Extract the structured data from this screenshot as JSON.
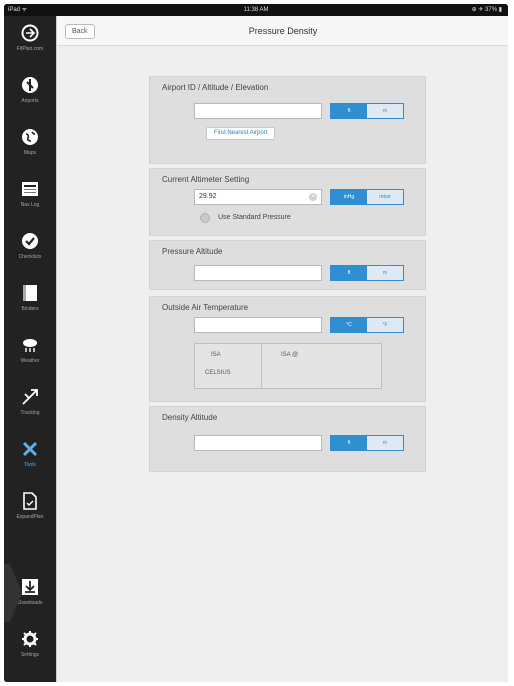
{
  "status": {
    "carrier": "iPad ᯤ",
    "time": "11:38 AM",
    "battery": "⊕ ✈ 37% ▮"
  },
  "sidebar": {
    "items": [
      {
        "label": "FltPlan.com",
        "icon": "fltplan-logo-icon"
      },
      {
        "label": "Airports",
        "icon": "airport-icon"
      },
      {
        "label": "Maps",
        "icon": "globe-icon"
      },
      {
        "label": "Nav Log",
        "icon": "navlog-icon"
      },
      {
        "label": "Checklists",
        "icon": "checkmark-icon"
      },
      {
        "label": "Binders",
        "icon": "binder-icon"
      },
      {
        "label": "Weather",
        "icon": "weather-icon"
      },
      {
        "label": "Tracking",
        "icon": "tracking-icon"
      },
      {
        "label": "Tools",
        "icon": "tools-icon",
        "active": true
      },
      {
        "label": "ExpandPlan",
        "icon": "document-icon"
      },
      {
        "label": "Downloads",
        "icon": "download-icon"
      },
      {
        "label": "Settings",
        "icon": "gear-icon"
      }
    ]
  },
  "nav": {
    "back": "Back",
    "title": "Pressure Density"
  },
  "sections": {
    "airport": {
      "title": "Airport ID / Altitude / Elevation",
      "value": "",
      "unit_on": "ft",
      "unit_off": "m",
      "find_btn": "Find Nearest Airport"
    },
    "altimeter": {
      "title": "Current Altimeter Setting",
      "value": "29.92",
      "unit_on": "inHg",
      "unit_off": "mbar",
      "toggle_label": "Use Standard Pressure"
    },
    "pressure_alt": {
      "title": "Pressure Altitude",
      "value": "",
      "unit_on": "ft",
      "unit_off": "m"
    },
    "oat": {
      "title": "Outside Air Temperature",
      "value": "",
      "unit_on": "°C",
      "unit_off": "°F",
      "isa_label": "ISA",
      "isa_unit": "CELSIUS",
      "isa_at": "ISA @"
    },
    "density_alt": {
      "title": "Density Altitude",
      "value": "",
      "unit_on": "ft",
      "unit_off": "m"
    }
  },
  "colors": {
    "accent": "#2f8fd0",
    "sidebar": "#222222",
    "panel": "#efefef",
    "section": "#dedede"
  }
}
